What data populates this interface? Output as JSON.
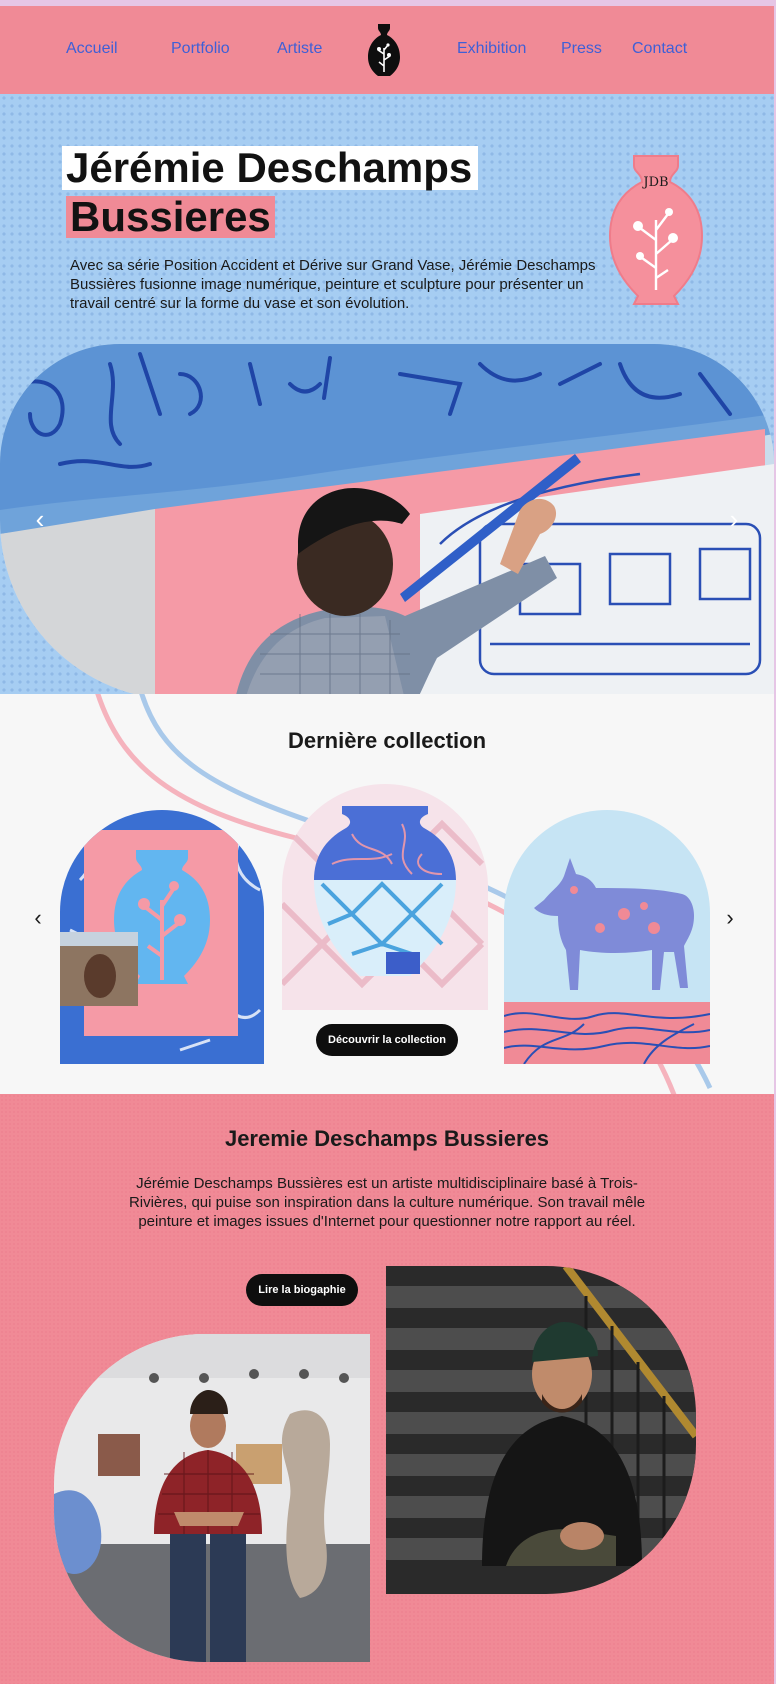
{
  "nav": {
    "items": [
      "Accueil",
      "Portfolio",
      "Artiste",
      "Exhibition",
      "Press",
      "Contact"
    ],
    "logo_icon": "vase-logo-icon"
  },
  "hero": {
    "title_line1": "Jérémie Deschamps",
    "title_line2": "Bussieres",
    "description": "Avec sa série Position Accident et Dérive sur Grand Vase, Jérémie Deschamps Bussières fusionne image numérique, peinture et sculpture pour  présenter un travail centré sur la forme du vase et son évolution.",
    "vase_initials": "JDB",
    "slider_prev": "‹",
    "slider_next": "›"
  },
  "collection": {
    "title": "Dernière collection",
    "button_label": "Découvrir la collection",
    "prev": "‹",
    "next": "›"
  },
  "artist": {
    "title": "Jeremie Deschamps Bussieres",
    "description": "Jérémie Deschamps Bussières est un artiste multidisciplinaire basé à Trois-Rivières, qui puise son inspiration dans la culture numérique. Son travail mêle peinture et images issues d'Internet pour questionner notre rapport au réel.",
    "button_label": "Lire la biogaphie"
  },
  "colors": {
    "nav_bg": "#f08a96",
    "nav_link": "#3f5fd6",
    "hero_bg": "#a6cdf2",
    "pink": "#f08a96",
    "blue_ink": "#2a4fb5",
    "button_bg": "#0e0e0e"
  }
}
